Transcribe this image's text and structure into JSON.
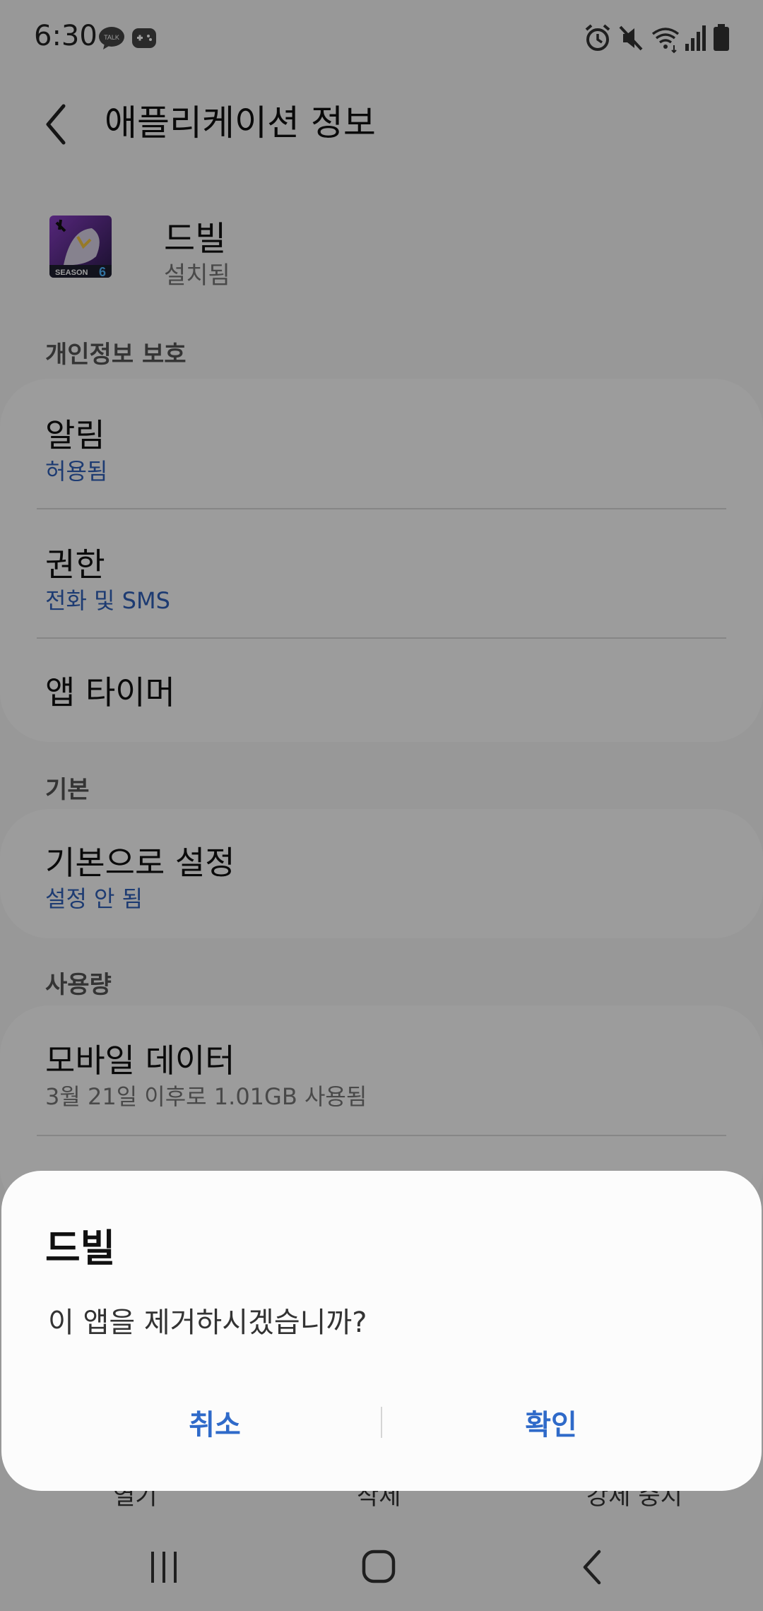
{
  "status_bar": {
    "time": "6:30",
    "left_icons": [
      "kakaotalk-icon",
      "game-icon"
    ],
    "right_icons": [
      "alarm-icon",
      "mute-icon",
      "wifi-icon",
      "signal-icon",
      "battery-icon"
    ],
    "talk_badge": "TALK"
  },
  "header": {
    "title": "애플리케이션 정보",
    "back_icon": "back-icon"
  },
  "app": {
    "name": "드빌",
    "status": "설치됨",
    "icon_label": "SEASON",
    "icon_number": "6"
  },
  "sections": {
    "privacy": {
      "header": "개인정보 보호",
      "items": [
        {
          "title": "알림",
          "subtitle": "허용됨"
        },
        {
          "title": "권한",
          "subtitle": "전화 및 SMS"
        },
        {
          "title": "앱 타이머"
        }
      ]
    },
    "default": {
      "header": "기본",
      "items": [
        {
          "title": "기본으로 설정",
          "subtitle": "설정 안 됨"
        }
      ]
    },
    "usage": {
      "header": "사용량",
      "items": [
        {
          "title": "모바일 데이터",
          "subtitle": "3월 21일 이후로 1.01GB 사용됨"
        }
      ]
    }
  },
  "bottom_actions": {
    "open": "열기",
    "uninstall": "삭제",
    "force_stop": "강제 중지"
  },
  "dialog": {
    "title": "드빌",
    "message": "이 앱을 제거하시겠습니까?",
    "cancel": "취소",
    "confirm": "확인"
  },
  "nav_bar": {
    "icons": [
      "recent-apps-icon",
      "home-icon",
      "back-icon"
    ]
  },
  "colors": {
    "accent": "#2f6ac9",
    "subtitle_blue": "#2f5fb8",
    "scrim": "rgba(0,0,0,0.38)",
    "background": "#f6f6f6",
    "card": "#fcfcfc"
  }
}
